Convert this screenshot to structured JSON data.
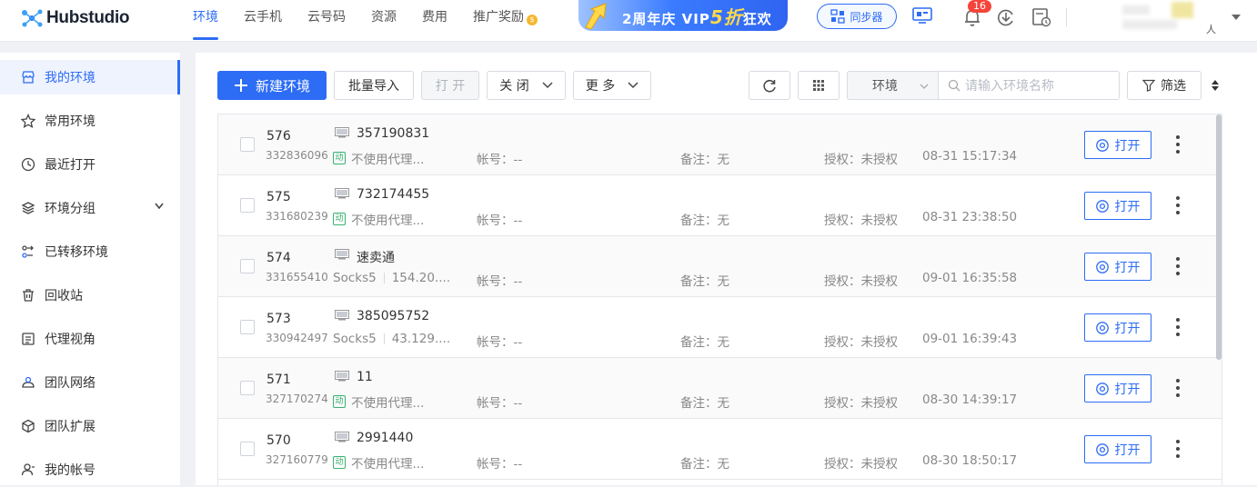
{
  "app": {
    "logo_text": "Hubstudio"
  },
  "nav": [
    "环境",
    "云手机",
    "云号码",
    "资源",
    "费用",
    "推广奖励"
  ],
  "banner": {
    "prefix": "2周年庆 VIP",
    "highlight": "5折",
    "suffix": "狂欢"
  },
  "sync_label": "同步器",
  "notification_count": "16",
  "user": {
    "suffix": "人"
  },
  "sidebar": [
    {
      "label": "我的环境",
      "icon": "store-icon",
      "active": true
    },
    {
      "label": "常用环境",
      "icon": "star-icon"
    },
    {
      "label": "最近打开",
      "icon": "clock-icon"
    },
    {
      "label": "环境分组",
      "icon": "layers-icon",
      "expandable": true
    },
    {
      "label": "已转移环境",
      "icon": "transfer-icon"
    },
    {
      "label": "回收站",
      "icon": "trash-icon"
    },
    {
      "label": "代理视角",
      "icon": "proxy-icon"
    },
    {
      "label": "团队网络",
      "icon": "team-network-icon"
    },
    {
      "label": "团队扩展",
      "icon": "extension-icon"
    },
    {
      "label": "我的帐号",
      "icon": "user-icon"
    }
  ],
  "toolbar": {
    "new_label": "新建环境",
    "import_label": "批量导入",
    "open_label": "打 开",
    "close_label": "关 闭",
    "more_label": "更 多",
    "env_select": "环境",
    "search_placeholder": "请输入环境名称",
    "filter_label": "筛选"
  },
  "rows": [
    {
      "num": "576",
      "uid": "332836096",
      "name": "357190831",
      "proxy_type": "dynamic",
      "proxy": "不使用代理...",
      "proxy_addr": "",
      "account": "帐号：--",
      "note": "备注：无",
      "auth": "授权：未授权",
      "time": "08-31 15:17:34",
      "open": "打开"
    },
    {
      "num": "575",
      "uid": "331680239",
      "name": "732174455",
      "proxy_type": "dynamic",
      "proxy": "不使用代理...",
      "proxy_addr": "",
      "account": "帐号：--",
      "note": "备注：无",
      "auth": "授权：未授权",
      "time": "08-31 23:38:50",
      "open": "打开"
    },
    {
      "num": "574",
      "uid": "331655410",
      "name": "速卖通",
      "proxy_type": "socks",
      "proxy": "Socks5",
      "proxy_addr": "154.20....",
      "account": "帐号：--",
      "note": "备注：无",
      "auth": "授权：未授权",
      "time": "09-01 16:35:58",
      "open": "打开"
    },
    {
      "num": "573",
      "uid": "330942497",
      "name": "385095752",
      "proxy_type": "socks",
      "proxy": "Socks5",
      "proxy_addr": "43.129....",
      "account": "帐号：--",
      "note": "备注：无",
      "auth": "授权：未授权",
      "time": "09-01 16:39:43",
      "open": "打开"
    },
    {
      "num": "571",
      "uid": "327170274",
      "name": "11",
      "proxy_type": "dynamic",
      "proxy": "不使用代理...",
      "proxy_addr": "",
      "account": "帐号：--",
      "note": "备注：无",
      "auth": "授权：未授权",
      "time": "08-30 14:39:17",
      "open": "打开"
    },
    {
      "num": "570",
      "uid": "327160779",
      "name": "2991440",
      "proxy_type": "dynamic",
      "proxy": "不使用代理...",
      "proxy_addr": "",
      "account": "帐号：--",
      "note": "备注：无",
      "auth": "授权：未授权",
      "time": "08-30 18:50:17",
      "open": "打开"
    }
  ],
  "dynamic_tag": "动",
  "colors": {
    "primary": "#2d6cf5",
    "badge": "#f5453b",
    "dynamic": "#38b26f"
  }
}
